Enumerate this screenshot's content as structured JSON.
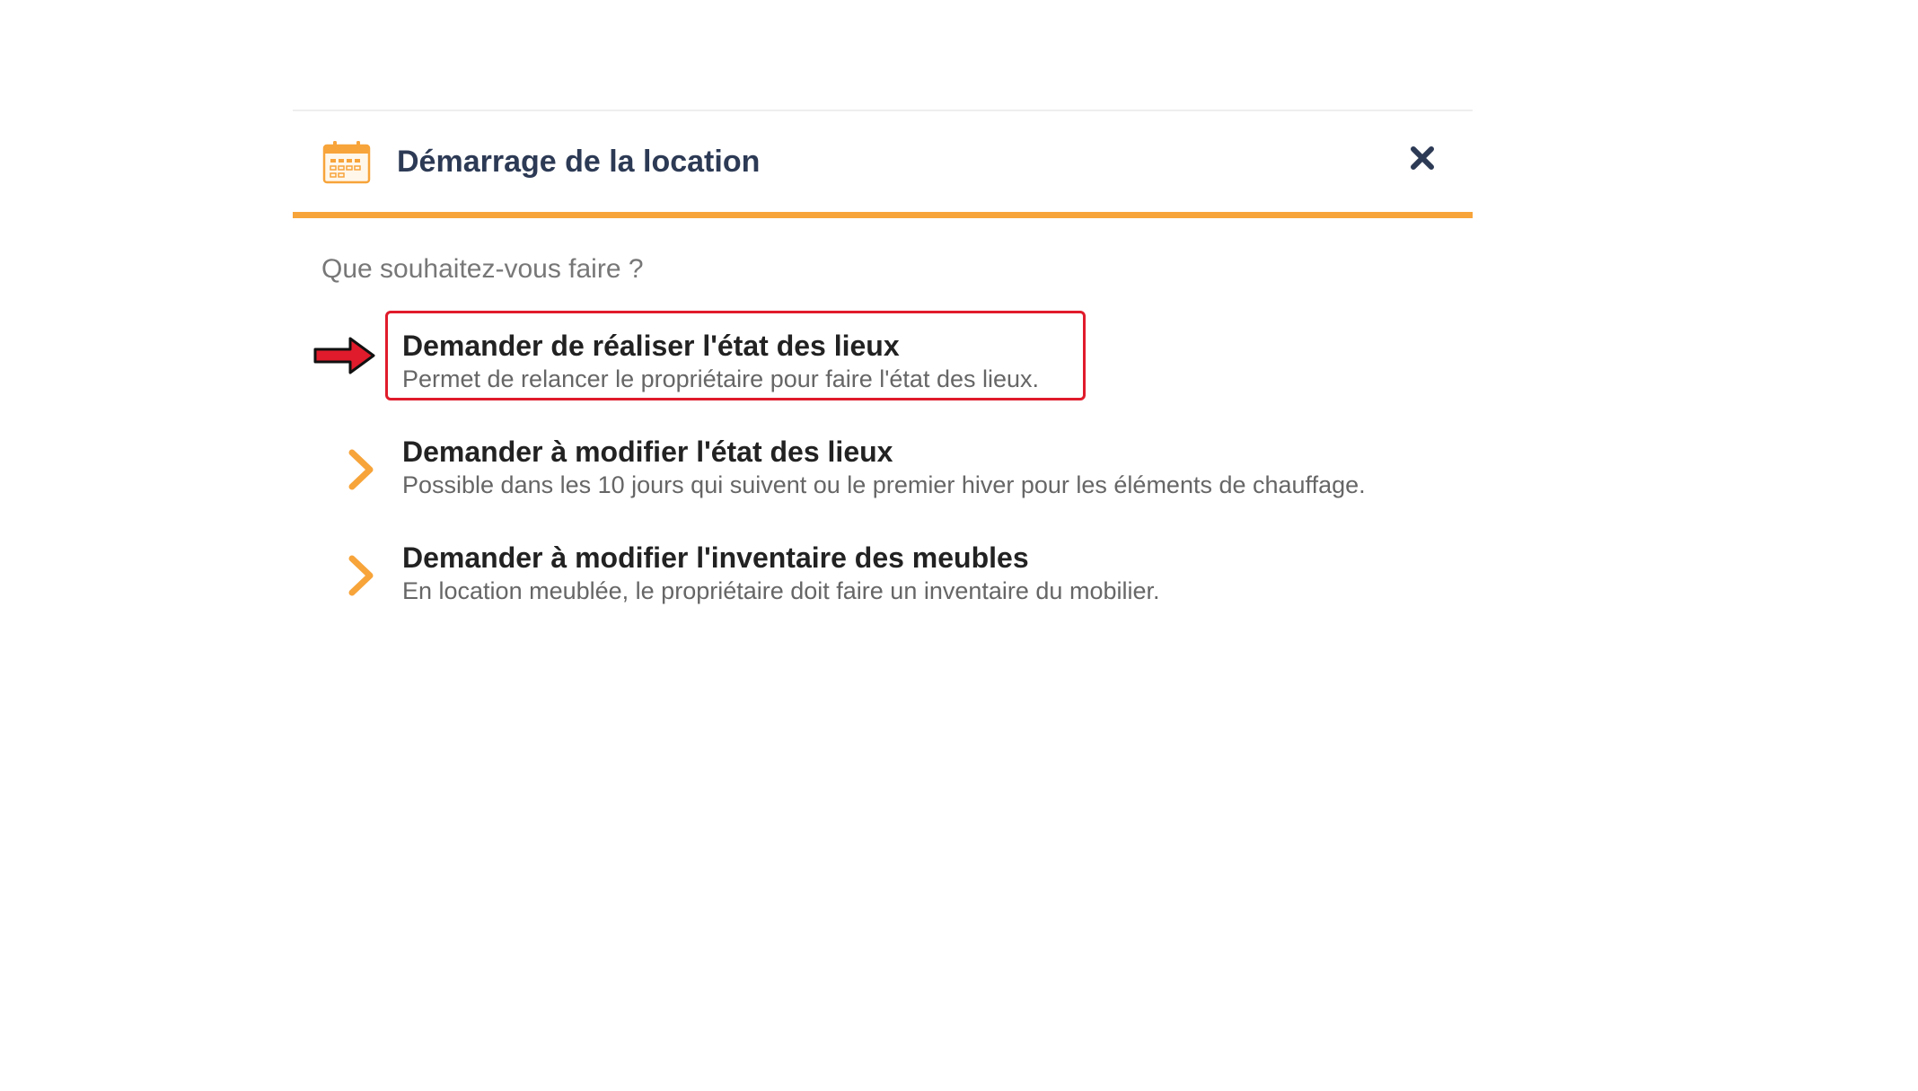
{
  "dialog": {
    "title": "Démarrage de la location",
    "header_icon": "calendar-icon",
    "close_icon": "close-icon",
    "prompt": "Que souhaitez-vous faire ?",
    "options": [
      {
        "title": "Demander de réaliser l'état des lieux",
        "description": "Permet de relancer le propriétaire pour faire l'état des lieux."
      },
      {
        "title": "Demander à modifier l'état des lieux",
        "description": "Possible dans les 10 jours qui suivent ou le premier hiver pour les éléments de chauffage."
      },
      {
        "title": "Demander à modifier l'inventaire des meubles",
        "description": "En location meublée, le propriétaire doit faire un inventaire du mobilier."
      }
    ]
  },
  "colors": {
    "accent": "#f7a43a",
    "title_text": "#2d3a55",
    "highlight_border": "#e01b2b",
    "annotation_arrow": "#e01b2b"
  }
}
